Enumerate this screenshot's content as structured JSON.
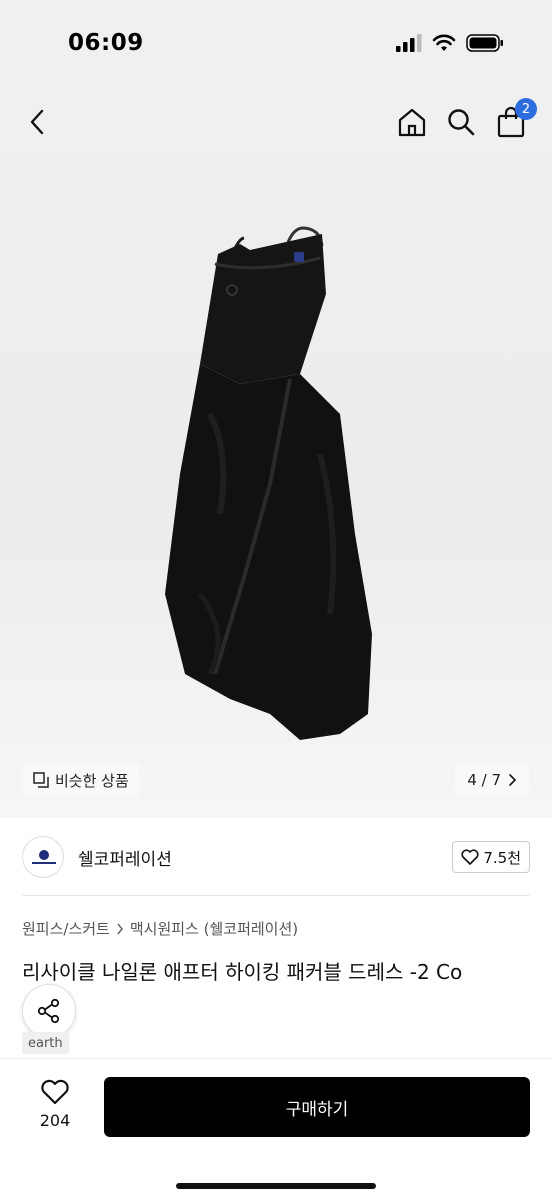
{
  "status_bar": {
    "time": "06:09"
  },
  "nav": {
    "cart_count": "2"
  },
  "hero": {
    "similar_label": "비슷한 상품",
    "page_indicator": "4 / 7"
  },
  "brand": {
    "name": "쉘코퍼레이션",
    "likes": "7.5천"
  },
  "breadcrumb": {
    "category": "원피스/스커트",
    "subcategory": "맥시원피스 (쉘코퍼레이션)"
  },
  "product": {
    "title": "리사이클 나일론 애프터 하이킹 패커블 드레스 -2 Co",
    "tag": "earth"
  },
  "bottom": {
    "wish_count": "204",
    "buy_label": "구매하기"
  },
  "colors": {
    "badge": "#2d6cdf",
    "buy_button": "#000000",
    "dress": "#111111"
  }
}
